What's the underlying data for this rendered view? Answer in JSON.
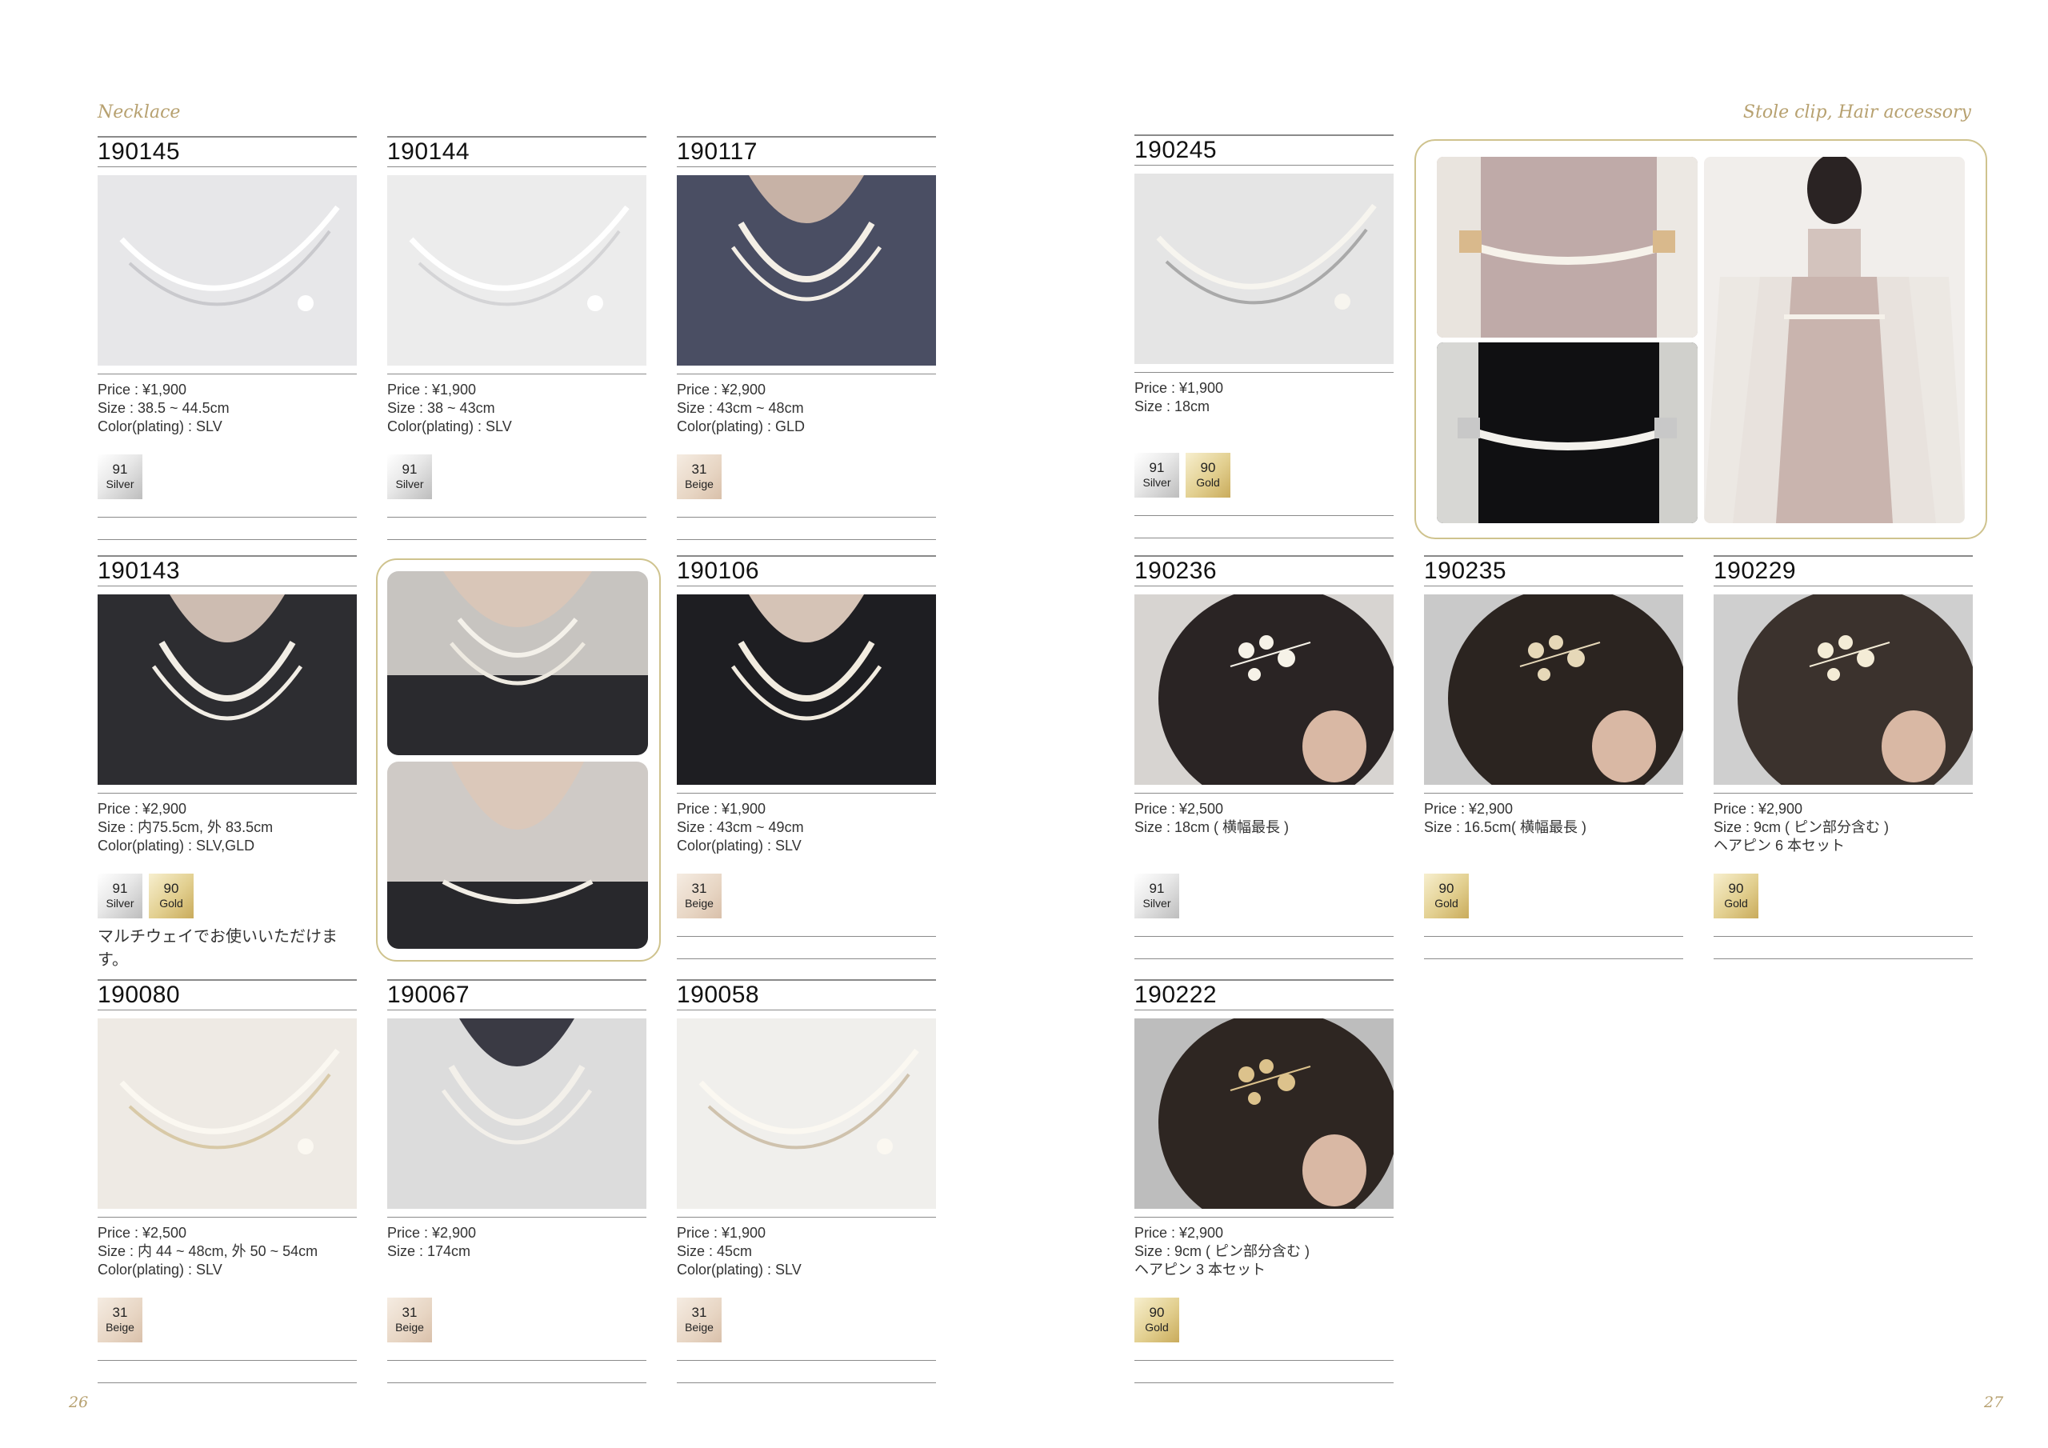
{
  "left_page": {
    "section_label": "Necklace",
    "page_number": "26",
    "items": [
      {
        "code": "190145",
        "info": [
          "Price : ¥1,900",
          "Size : 38.5 ~ 44.5cm",
          "Color(plating) : SLV"
        ],
        "swatches": [
          {
            "num": "91",
            "name": "Silver",
            "kind": "silver"
          }
        ]
      },
      {
        "code": "190144",
        "info": [
          "Price : ¥1,900",
          "Size : 38 ~ 43cm",
          "Color(plating) : SLV"
        ],
        "swatches": [
          {
            "num": "91",
            "name": "Silver",
            "kind": "silver"
          }
        ]
      },
      {
        "code": "190117",
        "info": [
          "Price : ¥2,900",
          "Size : 43cm ~ 48cm",
          "Color(plating) : GLD"
        ],
        "swatches": [
          {
            "num": "31",
            "name": "Beige",
            "kind": "beige"
          }
        ]
      },
      {
        "code": "190143",
        "info": [
          "Price : ¥2,900",
          "Size : 内75.5cm, 外 83.5cm",
          "Color(plating) : SLV,GLD"
        ],
        "swatches": [
          {
            "num": "91",
            "name": "Silver",
            "kind": "silver"
          },
          {
            "num": "90",
            "name": "Gold",
            "kind": "gold"
          }
        ],
        "note": "マルチウェイでお使いいただけます。"
      },
      {
        "code": "190106",
        "info": [
          "Price : ¥1,900",
          "Size : 43cm ~ 49cm",
          "Color(plating) : SLV"
        ],
        "swatches": [
          {
            "num": "31",
            "name": "Beige",
            "kind": "beige"
          }
        ]
      },
      {
        "code": "190080",
        "info": [
          "Price : ¥2,500",
          "Size : 内 44 ~ 48cm, 外 50 ~ 54cm",
          "Color(plating) : SLV"
        ],
        "swatches": [
          {
            "num": "31",
            "name": "Beige",
            "kind": "beige"
          }
        ]
      },
      {
        "code": "190067",
        "info": [
          "Price : ¥2,900",
          "Size : 174cm"
        ],
        "swatches": [
          {
            "num": "31",
            "name": "Beige",
            "kind": "beige"
          }
        ]
      },
      {
        "code": "190058",
        "info": [
          "Price : ¥1,900",
          "Size : 45cm",
          "Color(plating) : SLV"
        ],
        "swatches": [
          {
            "num": "31",
            "name": "Beige",
            "kind": "beige"
          }
        ]
      }
    ]
  },
  "right_page": {
    "section_label": "Stole clip, Hair accessory",
    "page_number": "27",
    "items": [
      {
        "code": "190245",
        "info": [
          "Price : ¥1,900",
          "Size : 18cm"
        ],
        "swatches": [
          {
            "num": "91",
            "name": "Silver",
            "kind": "silver"
          },
          {
            "num": "90",
            "name": "Gold",
            "kind": "gold"
          }
        ]
      },
      {
        "code": "190236",
        "info": [
          "Price : ¥2,500",
          "Size :  18cm ( 横幅最長 )"
        ],
        "swatches": [
          {
            "num": "91",
            "name": "Silver",
            "kind": "silver"
          }
        ]
      },
      {
        "code": "190235",
        "info": [
          "Price : ¥2,900",
          "Size :  16.5cm( 横幅最長 )"
        ],
        "swatches": [
          {
            "num": "90",
            "name": "Gold",
            "kind": "gold"
          }
        ]
      },
      {
        "code": "190229",
        "info": [
          "Price : ¥2,900",
          "Size :  9cm ( ピン部分含む )",
          "ヘアピン 6 本セット"
        ],
        "swatches": [
          {
            "num": "90",
            "name": "Gold",
            "kind": "gold"
          }
        ]
      },
      {
        "code": "190222",
        "info": [
          "Price : ¥2,900",
          "Size :  9cm ( ピン部分含む )",
          "ヘアピン 3 本セット"
        ],
        "swatches": [
          {
            "num": "90",
            "name": "Gold",
            "kind": "gold"
          }
        ]
      }
    ]
  }
}
